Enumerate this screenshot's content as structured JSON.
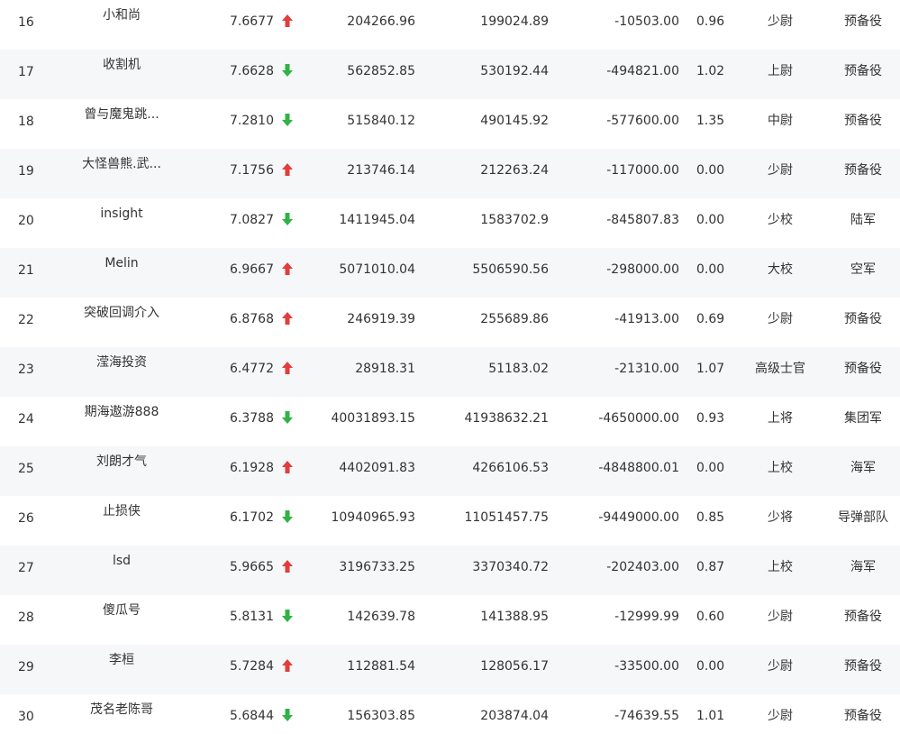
{
  "colors": {
    "up": "#e33c3c",
    "down": "#2fb344",
    "row_alt_bg": "#f6f7f9",
    "text": "#333333"
  },
  "rows": [
    {
      "rank": "16",
      "name": "小和尚",
      "score": "7.6677",
      "trend": "up",
      "value1": "204266.96",
      "value2": "199024.89",
      "value3": "-10503.00",
      "ratio": "0.96",
      "rank_title": "少尉",
      "unit": "预备役"
    },
    {
      "rank": "17",
      "name": "收割机",
      "score": "7.6628",
      "trend": "down",
      "value1": "562852.85",
      "value2": "530192.44",
      "value3": "-494821.00",
      "ratio": "1.02",
      "rank_title": "上尉",
      "unit": "预备役"
    },
    {
      "rank": "18",
      "name": "曾与魔鬼跳...",
      "score": "7.2810",
      "trend": "down",
      "value1": "515840.12",
      "value2": "490145.92",
      "value3": "-577600.00",
      "ratio": "1.35",
      "rank_title": "中尉",
      "unit": "预备役"
    },
    {
      "rank": "19",
      "name": "大怪兽熊.武...",
      "score": "7.1756",
      "trend": "up",
      "value1": "213746.14",
      "value2": "212263.24",
      "value3": "-117000.00",
      "ratio": "0.00",
      "rank_title": "少尉",
      "unit": "预备役"
    },
    {
      "rank": "20",
      "name": "insight",
      "score": "7.0827",
      "trend": "down",
      "value1": "1411945.04",
      "value2": "1583702.9",
      "value3": "-845807.83",
      "ratio": "0.00",
      "rank_title": "少校",
      "unit": "陆军"
    },
    {
      "rank": "21",
      "name": "Melin",
      "score": "6.9667",
      "trend": "up",
      "value1": "5071010.04",
      "value2": "5506590.56",
      "value3": "-298000.00",
      "ratio": "0.00",
      "rank_title": "大校",
      "unit": "空军"
    },
    {
      "rank": "22",
      "name": "突破回调介入",
      "score": "6.8768",
      "trend": "up",
      "value1": "246919.39",
      "value2": "255689.86",
      "value3": "-41913.00",
      "ratio": "0.69",
      "rank_title": "少尉",
      "unit": "预备役"
    },
    {
      "rank": "23",
      "name": "滢海投资",
      "score": "6.4772",
      "trend": "up",
      "value1": "28918.31",
      "value2": "51183.02",
      "value3": "-21310.00",
      "ratio": "1.07",
      "rank_title": "高级士官",
      "unit": "预备役"
    },
    {
      "rank": "24",
      "name": "期海遨游888",
      "score": "6.3788",
      "trend": "down",
      "value1": "40031893.15",
      "value2": "41938632.21",
      "value3": "-4650000.00",
      "ratio": "0.93",
      "rank_title": "上将",
      "unit": "集团军"
    },
    {
      "rank": "25",
      "name": "刘朗才气",
      "score": "6.1928",
      "trend": "up",
      "value1": "4402091.83",
      "value2": "4266106.53",
      "value3": "-4848800.01",
      "ratio": "0.00",
      "rank_title": "上校",
      "unit": "海军"
    },
    {
      "rank": "26",
      "name": "止损侠",
      "score": "6.1702",
      "trend": "down",
      "value1": "10940965.93",
      "value2": "11051457.75",
      "value3": "-9449000.00",
      "ratio": "0.85",
      "rank_title": "少将",
      "unit": "导弹部队"
    },
    {
      "rank": "27",
      "name": "lsd",
      "score": "5.9665",
      "trend": "up",
      "value1": "3196733.25",
      "value2": "3370340.72",
      "value3": "-202403.00",
      "ratio": "0.87",
      "rank_title": "上校",
      "unit": "海军"
    },
    {
      "rank": "28",
      "name": "傻瓜号",
      "score": "5.8131",
      "trend": "down",
      "value1": "142639.78",
      "value2": "141388.95",
      "value3": "-12999.99",
      "ratio": "0.60",
      "rank_title": "少尉",
      "unit": "预备役"
    },
    {
      "rank": "29",
      "name": "李桓",
      "score": "5.7284",
      "trend": "up",
      "value1": "112881.54",
      "value2": "128056.17",
      "value3": "-33500.00",
      "ratio": "0.00",
      "rank_title": "少尉",
      "unit": "预备役"
    },
    {
      "rank": "30",
      "name": "茂名老陈哥",
      "score": "5.6844",
      "trend": "down",
      "value1": "156303.85",
      "value2": "203874.04",
      "value3": "-74639.55",
      "ratio": "1.01",
      "rank_title": "少尉",
      "unit": "预备役"
    }
  ]
}
